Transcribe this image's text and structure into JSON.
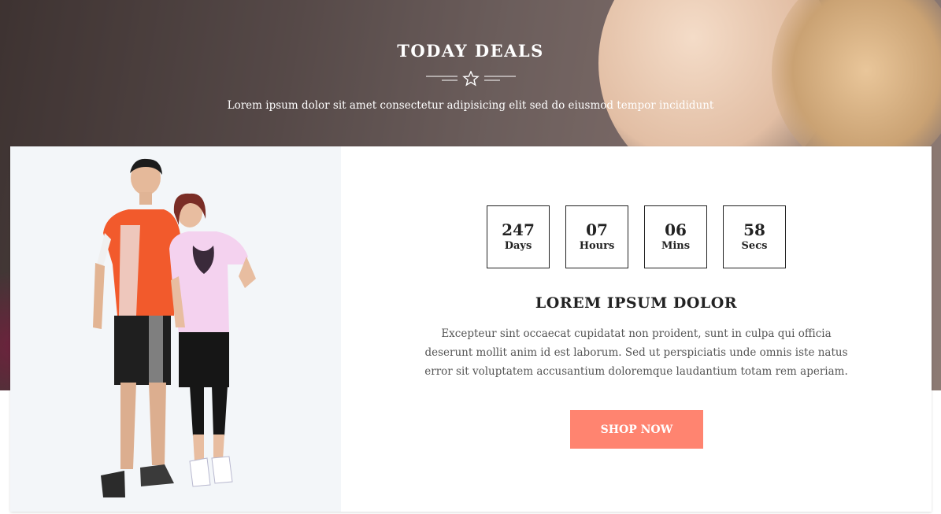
{
  "section": {
    "title": "TODAY DEALS",
    "subtitle": "Lorem ipsum dolor sit amet consectetur adipisicing elit sed do eiusmod tempor incididunt"
  },
  "countdown": [
    {
      "value": "247",
      "label": "Days"
    },
    {
      "value": "07",
      "label": "Hours"
    },
    {
      "value": "06",
      "label": "Mins"
    },
    {
      "value": "58",
      "label": "Secs"
    }
  ],
  "deal": {
    "heading": "LOREM IPSUM DOLOR",
    "text": "Excepteur sint occaecat cupidatat non proident, sunt in culpa qui officia deserunt mollit anim id est laborum. Sed ut perspiciatis unde omnis iste natus error sit voluptatem accusantium doloremque laudantium totam rem aperiam.",
    "button_label": "SHOP NOW"
  },
  "colors": {
    "accent": "#ff8470",
    "text_dark": "#222222",
    "text_body": "#555555",
    "panel_bg": "#f3f6f9"
  },
  "icons": {
    "divider": "star-icon"
  }
}
